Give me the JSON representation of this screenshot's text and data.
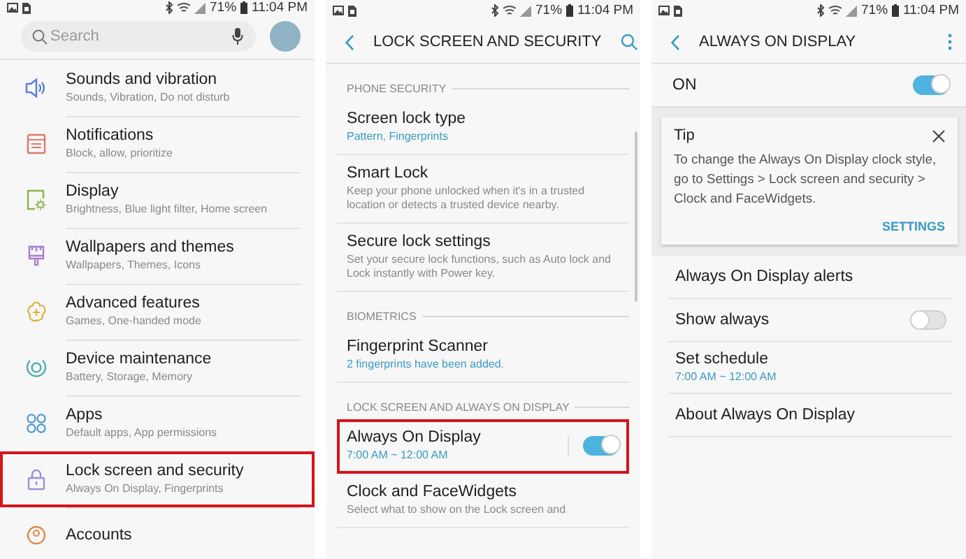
{
  "screens": [
    {
      "kind": "settings_list",
      "status_bar": {
        "battery": "71%",
        "time": "11:04 PM"
      },
      "search": {
        "placeholder": "Search"
      },
      "items": [
        {
          "title": "Sounds and vibration",
          "subtitle": "Sounds, Vibration, Do not disturb",
          "highlighted": false
        },
        {
          "title": "Notifications",
          "subtitle": "Block, allow, prioritize",
          "highlighted": false
        },
        {
          "title": "Display",
          "subtitle": "Brightness, Blue light filter, Home screen",
          "highlighted": false
        },
        {
          "title": "Wallpapers and themes",
          "subtitle": "Wallpapers, Themes, Icons",
          "highlighted": false
        },
        {
          "title": "Advanced features",
          "subtitle": "Games, One-handed mode",
          "highlighted": false
        },
        {
          "title": "Device maintenance",
          "subtitle": "Battery, Storage, Memory",
          "highlighted": false
        },
        {
          "title": "Apps",
          "subtitle": "Default apps, App permissions",
          "highlighted": false
        },
        {
          "title": "Lock screen and security",
          "subtitle": "Always On Display, Fingerprints",
          "highlighted": true
        },
        {
          "title": "Accounts",
          "highlighted": false
        }
      ]
    },
    {
      "kind": "detail",
      "status_bar": {
        "battery": "71%",
        "time": "11:04 PM"
      },
      "title": "LOCK SCREEN AND SECURITY",
      "action": {
        "kind": "search"
      },
      "rows": [
        {
          "kind": "header",
          "text": "PHONE SECURITY"
        },
        {
          "kind": "item",
          "title": "Screen lock type",
          "subtitle": "Pattern, Fingerprints",
          "accent": true,
          "highlighted": false
        },
        {
          "kind": "item",
          "title": "Smart Lock",
          "subtitle": "Keep your phone unlocked when it's in a trusted location or detects a trusted device nearby.",
          "accent": false,
          "highlighted": false
        },
        {
          "kind": "item",
          "title": "Secure lock settings",
          "subtitle": "Set your secure lock functions, such as Auto lock and Lock instantly with Power key.",
          "accent": false,
          "highlighted": false
        },
        {
          "kind": "header",
          "text": "BIOMETRICS"
        },
        {
          "kind": "item",
          "title": "Fingerprint Scanner",
          "subtitle": "2 fingerprints have been added.",
          "accent": true,
          "highlighted": false
        },
        {
          "kind": "header",
          "text": "LOCK SCREEN AND ALWAYS ON DISPLAY"
        },
        {
          "kind": "toggle",
          "title": "Always On Display",
          "subtitle": "7:00 AM ~ 12:00 AM",
          "accent": true,
          "on": true,
          "highlighted": true
        },
        {
          "kind": "item",
          "title": "Clock and FaceWidgets",
          "subtitle": "Select what to show on the Lock screen and",
          "accent": false,
          "highlighted": false
        }
      ]
    },
    {
      "kind": "detail",
      "status_bar": {
        "battery": "71%",
        "time": "11:04 PM"
      },
      "title": "ALWAYS ON DISPLAY",
      "action": {
        "kind": "more"
      },
      "rows": [
        {
          "kind": "master",
          "title": "ON",
          "on": true
        },
        {
          "kind": "tip",
          "title": "Tip",
          "text": "To change the Always On Display clock style, go to Settings > Lock screen and security > Clock and FaceWidgets.",
          "button": "SETTINGS"
        },
        {
          "kind": "item",
          "title": "Always On Display alerts",
          "highlighted": false
        },
        {
          "kind": "toggle",
          "title": "Show always",
          "on": false,
          "highlighted": false
        },
        {
          "kind": "item",
          "title": "Set schedule",
          "subtitle": "7:00 AM ~ 12:00 AM",
          "accent": true,
          "highlighted": false
        },
        {
          "kind": "item",
          "title": "About Always On Display",
          "highlighted": false
        }
      ]
    }
  ]
}
